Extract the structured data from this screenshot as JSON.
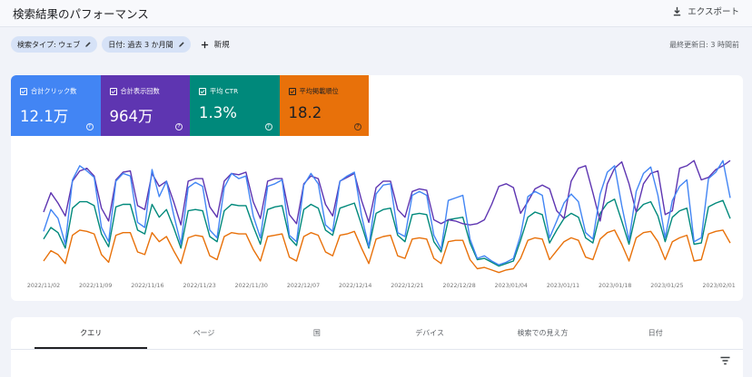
{
  "header": {
    "title": "検索結果のパフォーマンス",
    "export_label": "エクスポート"
  },
  "filters": {
    "search_type_chip": "検索タイプ: ウェブ",
    "date_chip": "日付: 過去 3 か月間",
    "new_label": "新規",
    "last_updated": "最終更新日: 3 時間前"
  },
  "metrics": [
    {
      "label": "合計クリック数",
      "value": "12.1万",
      "color": "#4285f4"
    },
    {
      "label": "合計表示回数",
      "value": "964万",
      "color": "#5e35b1"
    },
    {
      "label": "平均 CTR",
      "value": "1.3%",
      "color": "#00897b"
    },
    {
      "label": "平均掲載順位",
      "value": "18.2",
      "color": "#e8710a"
    }
  ],
  "chart_data": {
    "type": "line",
    "x_labels": [
      "2022/11/02",
      "2022/11/09",
      "2022/11/16",
      "2022/11/23",
      "2022/11/30",
      "2022/12/07",
      "2022/12/14",
      "2022/12/21",
      "2022/12/28",
      "2023/01/04",
      "2023/01/11",
      "2023/01/18",
      "2023/01/25",
      "2023/02/01"
    ],
    "series_colors": {
      "clicks": "#4285f4",
      "impressions": "#5e35b1",
      "ctr": "#00897b",
      "position": "#e8710a"
    },
    "series": [
      {
        "metric": "clicks",
        "values": [
          35,
          52,
          45,
          25,
          75,
          86,
          82,
          77,
          38,
          27,
          74,
          80,
          78,
          42,
          38,
          83,
          62,
          74,
          48,
          25,
          69,
          73,
          70,
          36,
          30,
          69,
          80,
          76,
          78,
          47,
          30,
          70,
          72,
          75,
          32,
          27,
          71,
          80,
          72,
          40,
          35,
          74,
          78,
          81,
          47,
          23,
          64,
          71,
          72,
          34,
          31,
          63,
          66,
          63,
          32,
          21,
          59,
          61,
          63,
          29,
          14,
          16,
          12,
          9,
          11,
          14,
          32,
          62,
          66,
          63,
          30,
          43,
          57,
          64,
          58,
          34,
          29,
          64,
          81,
          86,
          55,
          28,
          66,
          80,
          85,
          63,
          30,
          59,
          70,
          75,
          27,
          30,
          76,
          81,
          90,
          61
        ]
      },
      {
        "metric": "impressions",
        "values": [
          50,
          65,
          57,
          47,
          74,
          82,
          84,
          78,
          53,
          43,
          75,
          81,
          82,
          55,
          52,
          80,
          70,
          74,
          58,
          40,
          74,
          76,
          76,
          54,
          46,
          74,
          80,
          79,
          81,
          58,
          45,
          74,
          76,
          76,
          48,
          41,
          72,
          78,
          76,
          56,
          47,
          74,
          77,
          80,
          59,
          42,
          69,
          74,
          74,
          52,
          46,
          66,
          68,
          67,
          44,
          41,
          44,
          43,
          41,
          40,
          41,
          44,
          56,
          70,
          72,
          69,
          49,
          58,
          68,
          71,
          68,
          51,
          45,
          74,
          84,
          86,
          65,
          43,
          72,
          84,
          89,
          72,
          50,
          72,
          80,
          82,
          48,
          51,
          84,
          86,
          90,
          75,
          77,
          83,
          86,
          90
        ]
      },
      {
        "metric": "ctr",
        "values": [
          29,
          38,
          34,
          22,
          53,
          58,
          58,
          55,
          33,
          23,
          54,
          56,
          56,
          36,
          33,
          56,
          46,
          52,
          38,
          22,
          51,
          52,
          51,
          31,
          27,
          51,
          56,
          55,
          55,
          39,
          25,
          52,
          54,
          55,
          30,
          24,
          52,
          56,
          53,
          36,
          32,
          53,
          55,
          57,
          40,
          22,
          49,
          52,
          53,
          32,
          27,
          48,
          49,
          48,
          27,
          19,
          44,
          45,
          46,
          26,
          13,
          14,
          11,
          8,
          10,
          12,
          28,
          46,
          50,
          48,
          26,
          36,
          45,
          49,
          46,
          30,
          26,
          49,
          57,
          60,
          43,
          25,
          50,
          56,
          58,
          47,
          27,
          46,
          51,
          53,
          25,
          26,
          54,
          57,
          59,
          45
        ]
      },
      {
        "metric": "position",
        "values": [
          12,
          20,
          17,
          10,
          32,
          36,
          35,
          33,
          17,
          11,
          32,
          34,
          34,
          19,
          17,
          34,
          27,
          31,
          20,
          10,
          30,
          32,
          31,
          16,
          13,
          31,
          34,
          33,
          33,
          21,
          12,
          31,
          32,
          33,
          15,
          12,
          31,
          34,
          32,
          19,
          16,
          32,
          33,
          35,
          22,
          10,
          29,
          31,
          32,
          16,
          14,
          29,
          30,
          29,
          14,
          10,
          27,
          28,
          28,
          13,
          6,
          7,
          5,
          3,
          5,
          6,
          14,
          28,
          30,
          29,
          13,
          20,
          27,
          30,
          28,
          15,
          13,
          29,
          34,
          36,
          25,
          12,
          30,
          34,
          35,
          27,
          13,
          27,
          30,
          32,
          12,
          13,
          33,
          35,
          36,
          26
        ]
      }
    ]
  },
  "tabs": [
    "クエリ",
    "ページ",
    "国",
    "デバイス",
    "検索での見え方",
    "日付"
  ],
  "active_tab": 0
}
